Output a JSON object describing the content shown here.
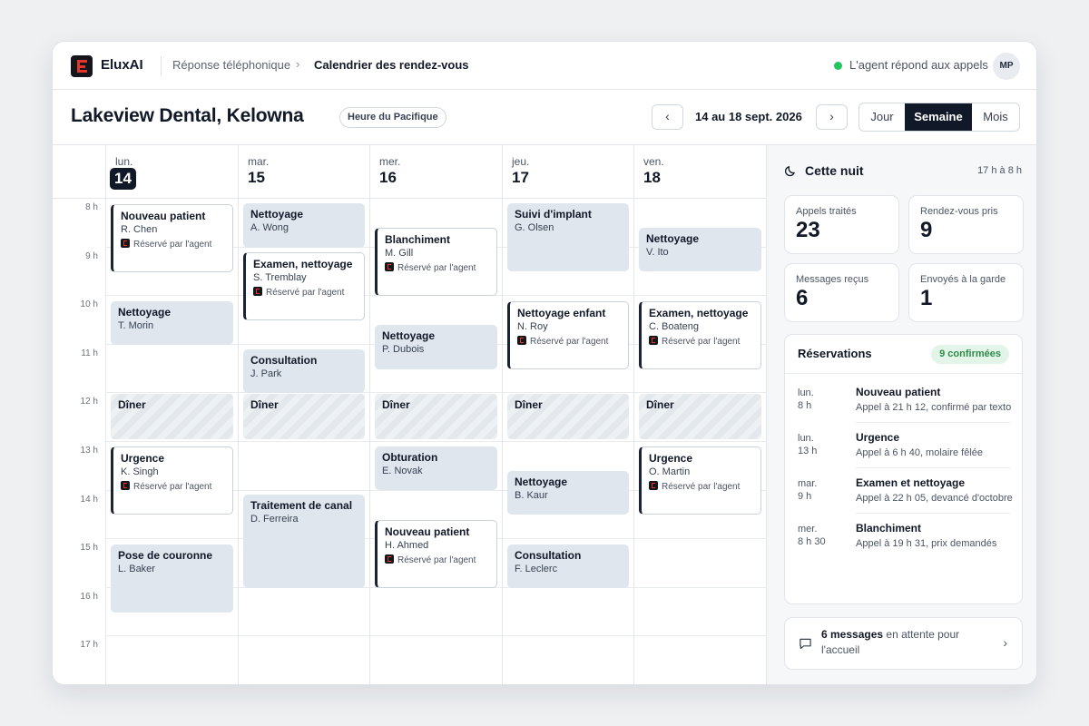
{
  "app": {
    "brand": "EluxAI",
    "breadcrumb": [
      "Réponse téléphonique",
      "Calendrier des rendez-vous"
    ],
    "breadcrumb_sep": "›",
    "status": "L'agent répond aux appels",
    "status_color": "#22c55e",
    "avatar": "MP"
  },
  "header": {
    "title": "Lakeview Dental, Kelowna",
    "timezone": "Heure du Pacifique",
    "prev": "‹",
    "next": "›",
    "date_range": "14 au 18 sept. 2026",
    "views": [
      "Jour",
      "Semaine",
      "Mois"
    ],
    "active_view": "Semaine"
  },
  "calendar": {
    "days": [
      {
        "name": "lun.",
        "num": "14",
        "today": true
      },
      {
        "name": "mar.",
        "num": "15"
      },
      {
        "name": "mer.",
        "num": "16"
      },
      {
        "name": "jeu.",
        "num": "17"
      },
      {
        "name": "ven.",
        "num": "18"
      }
    ],
    "hours": [
      "8 h",
      "9 h",
      "10 h",
      "11 h",
      "12 h",
      "13 h",
      "14 h",
      "15 h",
      "16 h",
      "17 h"
    ],
    "booked_tag": "Réservé par l'agent",
    "lunch_label": "Dîner",
    "events": {
      "mon_1": {
        "title": "Nouveau patient",
        "name": "R. Chen"
      },
      "mon_2": {
        "title": "Nettoyage",
        "name": "T. Morin"
      },
      "mon_3": {
        "title": "Urgence",
        "name": "K. Singh"
      },
      "mon_4": {
        "title": "Pose de couronne",
        "name": "L. Baker"
      },
      "tue_1": {
        "title": "Nettoyage",
        "name": "A. Wong"
      },
      "tue_2": {
        "title": "Examen, nettoyage",
        "name": "S. Tremblay"
      },
      "tue_3": {
        "title": "Consultation",
        "name": "J. Park"
      },
      "tue_4": {
        "title": "Traitement de canal",
        "name": "D. Ferreira"
      },
      "wed_1": {
        "title": "Blanchiment",
        "name": "M. Gill"
      },
      "wed_2": {
        "title": "Nettoyage",
        "name": "P. Dubois"
      },
      "wed_3": {
        "title": "Obturation",
        "name": "E. Novak"
      },
      "wed_4": {
        "title": "Nouveau patient",
        "name": "H. Ahmed"
      },
      "thu_1": {
        "title": "Suivi d'implant",
        "name": "G. Olsen"
      },
      "thu_2": {
        "title": "Nettoyage enfant",
        "name": "N. Roy"
      },
      "thu_3": {
        "title": "Nettoyage",
        "name": "B. Kaur"
      },
      "thu_4": {
        "title": "Consultation",
        "name": "F. Leclerc"
      },
      "fri_1": {
        "title": "Nettoyage",
        "name": "V. Ito"
      },
      "fri_2": {
        "title": "Examen, nettoyage",
        "name": "C. Boateng"
      },
      "fri_3": {
        "title": "Urgence",
        "name": "O. Martin"
      }
    }
  },
  "panel": {
    "title": "Cette nuit",
    "hours": "17 h à 8 h",
    "stats": [
      {
        "label": "Appels traités",
        "value": "23"
      },
      {
        "label": "Rendez-vous pris",
        "value": "9"
      },
      {
        "label": "Messages reçus",
        "value": "6"
      },
      {
        "label": "Envoyés à la garde",
        "value": "1"
      }
    ],
    "reservations": {
      "title": "Réservations",
      "badge": "9 confirmées",
      "items": [
        {
          "day": "lun.",
          "time": "8 h",
          "name": "Nouveau patient",
          "desc": "Appel à 21 h 12, confirmé par texto"
        },
        {
          "day": "lun.",
          "time": "13 h",
          "name": "Urgence",
          "desc": "Appel à 6 h 40, molaire fêlée"
        },
        {
          "day": "mar.",
          "time": "9 h",
          "name": "Examen et nettoyage",
          "desc": "Appel à 22 h 05, devancé d'octobre"
        },
        {
          "day": "mer.",
          "time": "8 h 30",
          "name": "Blanchiment",
          "desc": "Appel à 19 h 31, prix demandés"
        }
      ]
    },
    "messages": {
      "count": "6 messages",
      "rest": " en attente pour l'accueil",
      "chevron": "›"
    }
  }
}
